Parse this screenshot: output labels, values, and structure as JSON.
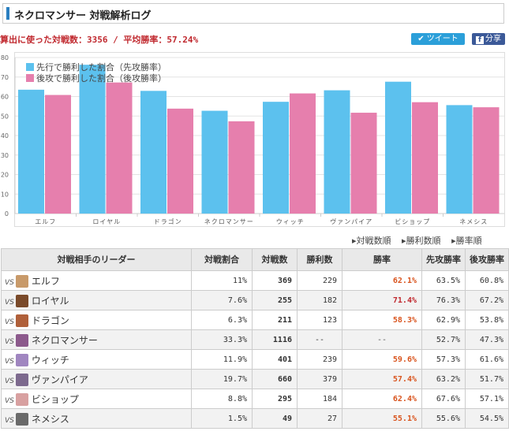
{
  "title": "ネクロマンサー 対戦解析ログ",
  "summary": "算出に使った対戦数：3356 / 平均勝率：57.24%",
  "buttons": {
    "tweet": "ツイート",
    "share": "分享"
  },
  "chart_data": {
    "type": "bar",
    "categories": [
      "エルフ",
      "ロイヤル",
      "ドラゴン",
      "ネクロマンサー",
      "ウィッチ",
      "ヴァンパイア",
      "ビショップ",
      "ネメシス"
    ],
    "series": [
      {
        "name": "先行で勝利した割合（先攻勝率）",
        "values": [
          63.5,
          76.3,
          62.9,
          52.7,
          57.3,
          63.2,
          67.6,
          55.6
        ],
        "color": "#5cc1ee"
      },
      {
        "name": "後攻で勝利した割合（後攻勝率）",
        "values": [
          60.8,
          67.2,
          53.8,
          47.3,
          61.6,
          51.7,
          57.1,
          54.5
        ],
        "color": "#e67fad"
      }
    ],
    "yticks": [
      0,
      10,
      20,
      30,
      40,
      50,
      60,
      70,
      80
    ],
    "ylim": [
      0,
      80
    ],
    "legend": "top-left"
  },
  "sort": {
    "by_count": "対戦数順",
    "by_wins": "勝利数順",
    "by_rate": "勝率順"
  },
  "table": {
    "headers": {
      "leader": "対戦相手のリーダー",
      "share": "対戦割合",
      "count": "対戦数",
      "wins": "勝利数",
      "rate": "勝率",
      "first": "先攻勝率",
      "second": "後攻勝率"
    },
    "vs_label": "VS",
    "rows": [
      {
        "name": "エルフ",
        "share": "11%",
        "count": "369",
        "wins": "229",
        "rate": "62.1%",
        "first": "63.5%",
        "second": "60.8%",
        "avatar": "#c89a6a"
      },
      {
        "name": "ロイヤル",
        "share": "7.6%",
        "count": "255",
        "wins": "182",
        "rate": "71.4%",
        "first": "76.3%",
        "second": "67.2%",
        "avatar": "#7a4a2a"
      },
      {
        "name": "ドラゴン",
        "share": "6.3%",
        "count": "211",
        "wins": "123",
        "rate": "58.3%",
        "first": "62.9%",
        "second": "53.8%",
        "avatar": "#b0603a"
      },
      {
        "name": "ネクロマンサー",
        "share": "33.3%",
        "count": "1116",
        "wins": "--",
        "rate": "--",
        "first": "52.7%",
        "second": "47.3%",
        "avatar": "#8c5a8c"
      },
      {
        "name": "ウィッチ",
        "share": "11.9%",
        "count": "401",
        "wins": "239",
        "rate": "59.6%",
        "first": "57.3%",
        "second": "61.6%",
        "avatar": "#a086c0"
      },
      {
        "name": "ヴァンパイア",
        "share": "19.7%",
        "count": "660",
        "wins": "379",
        "rate": "57.4%",
        "first": "63.2%",
        "second": "51.7%",
        "avatar": "#7d6a8e"
      },
      {
        "name": "ビショップ",
        "share": "8.8%",
        "count": "295",
        "wins": "184",
        "rate": "62.4%",
        "first": "67.6%",
        "second": "57.1%",
        "avatar": "#d8a0a0"
      },
      {
        "name": "ネメシス",
        "share": "1.5%",
        "count": "49",
        "wins": "27",
        "rate": "55.1%",
        "first": "55.6%",
        "second": "54.5%",
        "avatar": "#6a6a6a"
      }
    ]
  }
}
